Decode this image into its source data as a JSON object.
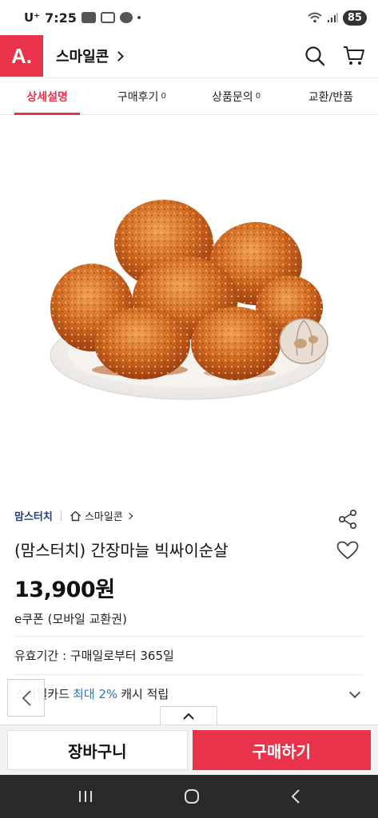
{
  "status_bar": {
    "carrier": "U⁺",
    "time": "7:25",
    "battery": "85"
  },
  "header": {
    "logo_text": "A.",
    "store_link": "스마일콘",
    "icons": [
      "search-icon",
      "cart-icon"
    ]
  },
  "tabs": [
    {
      "label": "상세설명",
      "count": "",
      "active": true
    },
    {
      "label": "구매후기",
      "count": "0",
      "active": false
    },
    {
      "label": "상품문의",
      "count": "0",
      "active": false
    },
    {
      "label": "교환/반품",
      "count": "",
      "active": false
    }
  ],
  "product": {
    "brand": "맘스터치",
    "store": "스마일콘",
    "title": "(맘스터치) 간장마늘 빅싸이순살",
    "price": "13,900원",
    "coupon_type": "e쿠폰 (모바일 교환권)",
    "validity": "유효기간 : 구매일로부터 365일",
    "cash_prefix": "스마일카드",
    "cash_highlight": "최대 2%",
    "cash_suffix": "캐시 적립"
  },
  "actions": {
    "cart_label": "장바구니",
    "buy_label": "구매하기"
  },
  "colors": {
    "accent": "#e8334a",
    "brand_blue": "#1c3f8a",
    "highlight_blue": "#2a74c9"
  }
}
